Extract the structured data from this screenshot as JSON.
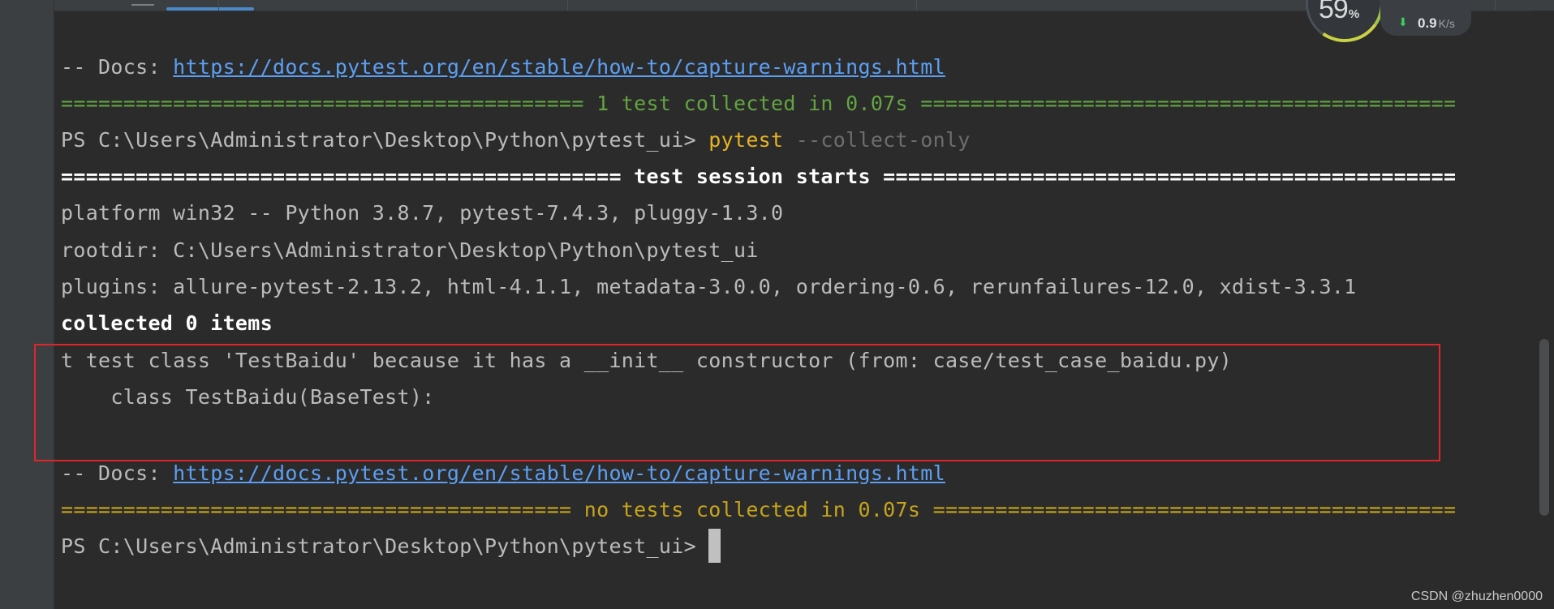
{
  "window": {
    "title": ""
  },
  "terminal": {
    "docs_prefix": "-- Docs: ",
    "docs_url": "https://docs.pytest.org/en/stable/how-to/capture-warnings.html",
    "summary_collected": "========================================== 1 test collected in 0.07s ===========================================",
    "prompt": "PS C:\\Users\\Administrator\\Desktop\\Python\\pytest_ui> ",
    "command": "pytest",
    "command_hint": " --collect-only",
    "session_header": "============================================= test session starts ==============================================",
    "platform_line": "platform win32 -- Python 3.8.7, pytest-7.4.3, pluggy-1.3.0",
    "rootdir_line": "rootdir: C:\\Users\\Administrator\\Desktop\\Python\\pytest_ui",
    "plugins_line": "plugins: allure-pytest-2.13.2, html-4.1.1, metadata-3.0.0, ordering-0.6, rerunfailures-12.0, xdist-3.3.1",
    "collected_line": "collected 0 items",
    "warning_line": "t test class 'TestBaidu' because it has a __init__ constructor (from: case/test_case_baidu.py)",
    "warning_source_line": "    class TestBaidu(BaseTest):",
    "summary_none": "========================================= no tests collected in 0.07s ==========================================",
    "prompt_final": "PS C:\\Users\\Administrator\\Desktop\\Python\\pytest_ui> "
  },
  "perf_widget": {
    "percent": "59",
    "percent_unit": "%",
    "speed_value": "0.9",
    "speed_unit": "K/s",
    "arrow_icon": "arrow-down-icon",
    "arrow_color": "#3fd15f"
  },
  "watermark": {
    "text": "CSDN @zhuzhen0000"
  },
  "colors": {
    "background": "#2b2b2b",
    "green_summary": "#62a540",
    "yellow_summary": "#c7a41b",
    "link": "#5c9ff2",
    "command": "#e6b422",
    "highlight_box": "#e0242c"
  }
}
